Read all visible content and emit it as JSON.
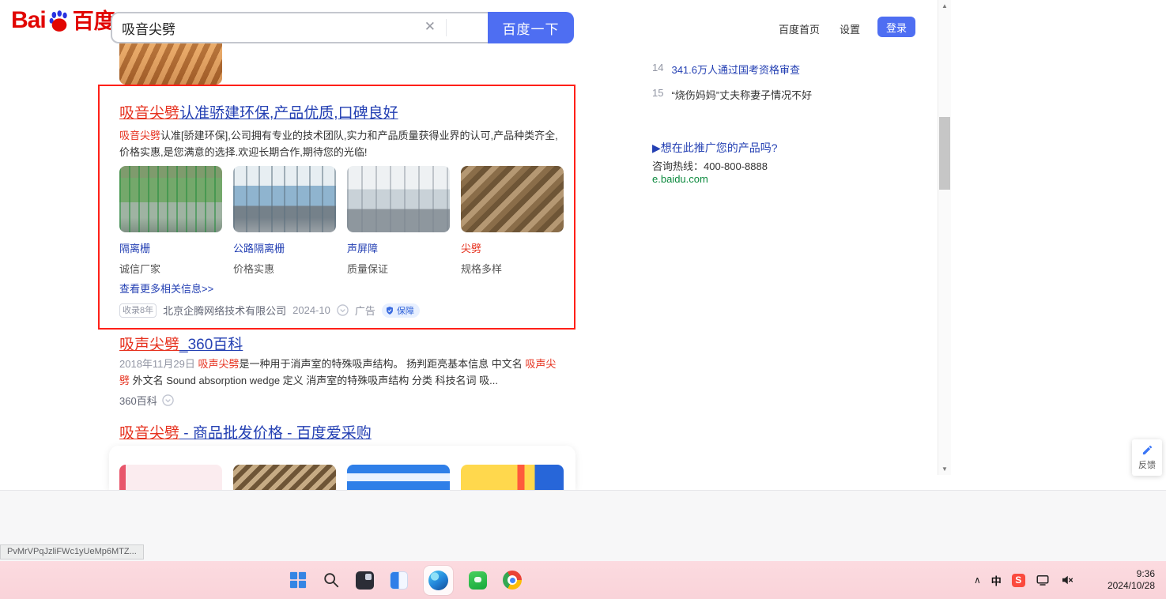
{
  "colors": {
    "accent": "#4e6ef2",
    "link": "#2440b3",
    "red": "#e6321f",
    "annot": "#ff2018",
    "green": "#0c8a3e",
    "logoRed": "#e10602",
    "logoBlue": "#2932e1",
    "taskbarPink": "#fbd8dd"
  },
  "header": {
    "logo": {
      "latin": "Bai",
      "cn": "百度"
    },
    "search": {
      "value": "吸音尖劈",
      "clear": "✕",
      "button": "百度一下"
    },
    "nav": {
      "home": "百度首页",
      "settings": "设置",
      "login": "登录"
    }
  },
  "ad": {
    "title": {
      "hl": "吸音尖劈",
      "rest": "认准骄建环保,产品优质,口碑良好"
    },
    "desc": {
      "hl": "吸音尖劈",
      "rest": "认准[骄建环保],公司拥有专业的技术团队,实力和产品质量获得业界的认可,产品种类齐全,价格实惠,是您满意的选择.欢迎长期合作,期待您的光临!"
    },
    "cards": [
      {
        "label": "隔离栅",
        "sub": "诚信厂家"
      },
      {
        "label": "公路隔离栅",
        "sub": "价格实惠"
      },
      {
        "label": "声屏障",
        "sub": "质量保证"
      },
      {
        "label": "尖劈",
        "sub": "规格多样"
      }
    ],
    "more": "查看更多相关信息>>",
    "meta": {
      "age": "收录8年",
      "source": "北京企腾网络技术有限公司",
      "date": "2024-10",
      "ad_label": "广告",
      "guarantee": "保障"
    }
  },
  "result2": {
    "title": {
      "hl": "吸声尖劈",
      "rest": "_360百科"
    },
    "desc": {
      "date": "2018年11月29日 ",
      "hl1": "吸声尖劈",
      "mid": "是一种用于消声室的特殊吸声结构。 扬判距亮基本信息 中文名 ",
      "hl2": "吸声尖劈",
      "tail": " 外文名 Sound absorption wedge 定义 消声室的特殊吸声结构 分类 科技名词 吸..."
    },
    "source": "360百科"
  },
  "result3": {
    "title": {
      "hl": "吸音尖劈",
      "rest": " - 商品批发价格 - 百度爱采购"
    }
  },
  "sidebar": {
    "hot_items": [
      {
        "rank": "14",
        "text": "341.6万人通过国考资格审查"
      },
      {
        "rank": "15",
        "text": "“烧伤妈妈”丈夫称妻子情况不好"
      }
    ],
    "promo": {
      "title": "▶想在此推广您的产品吗?",
      "hotline": "咨询热线：400-800-8888",
      "url": "e.baidu.com"
    }
  },
  "feedback": {
    "label": "反馈"
  },
  "tooltip": {
    "text": "PvMrVPqJzliFWc1yUeMp6MTZ..."
  },
  "taskbar": {
    "clock": {
      "time": "9:36",
      "date": "2024/10/28"
    },
    "tray": {
      "ime": "中",
      "sogou": "S"
    }
  },
  "icons": {
    "scrollUp": "▲",
    "scrollDown": "▼",
    "chevronUp": "∧"
  }
}
